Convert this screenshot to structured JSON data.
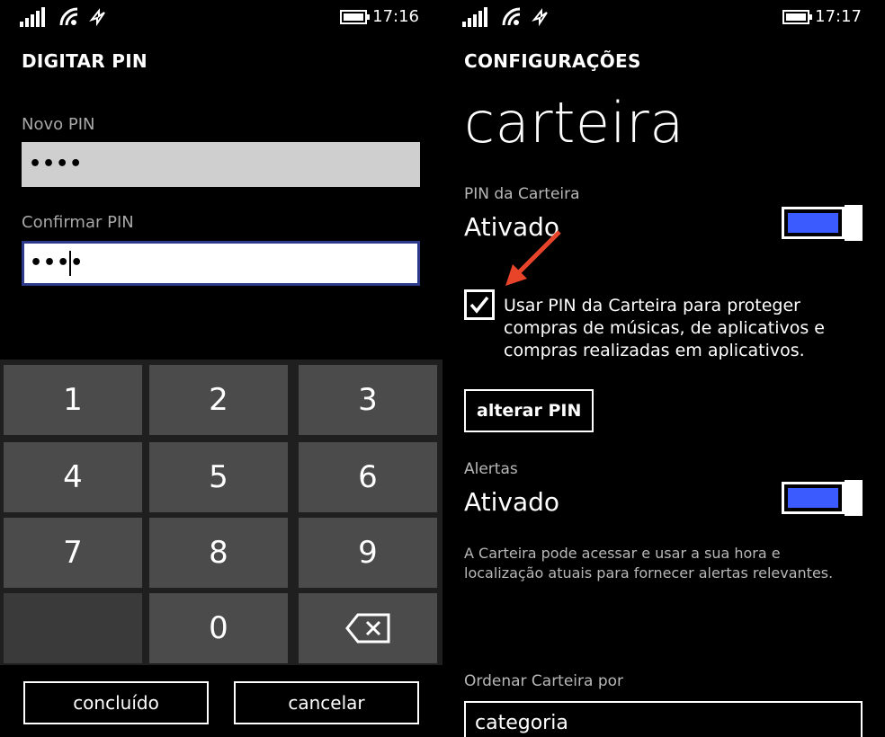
{
  "left": {
    "status": {
      "time": "17:16"
    },
    "page_title": "DIGITAR PIN",
    "new_pin": {
      "label": "Novo PIN",
      "value": "••••"
    },
    "confirm_pin": {
      "label": "Confirmar PIN",
      "value": "••••"
    },
    "keypad": {
      "keys": [
        "1",
        "2",
        "3",
        "4",
        "5",
        "6",
        "7",
        "8",
        "9",
        "0"
      ],
      "backspace_icon": "backspace-icon"
    },
    "buttons": {
      "done": "concluído",
      "cancel": "cancelar"
    }
  },
  "right": {
    "status": {
      "time": "17:17"
    },
    "page_title": "CONFIGURAÇÕES",
    "title": "carteira",
    "pin_setting": {
      "label": "PIN da Carteira",
      "value": "Ativado",
      "enabled": true
    },
    "checkbox": {
      "checked": true,
      "text": "Usar PIN da Carteira para proteger compras de músicas, de aplicativos e compras realizadas em aplicativos."
    },
    "change_pin_button": "alterar PIN",
    "alerts_setting": {
      "label": "Alertas",
      "value": "Ativado",
      "enabled": true
    },
    "alerts_description": "A Carteira pode acessar e usar a sua hora e localização atuais para fornecer alertas relevantes.",
    "sort_by": {
      "label": "Ordenar Carteira por",
      "value": "categoria"
    }
  },
  "colors": {
    "accent": "#3b5bff",
    "arrow": "#e8442a",
    "keypad_key": "#4b4b4b"
  }
}
